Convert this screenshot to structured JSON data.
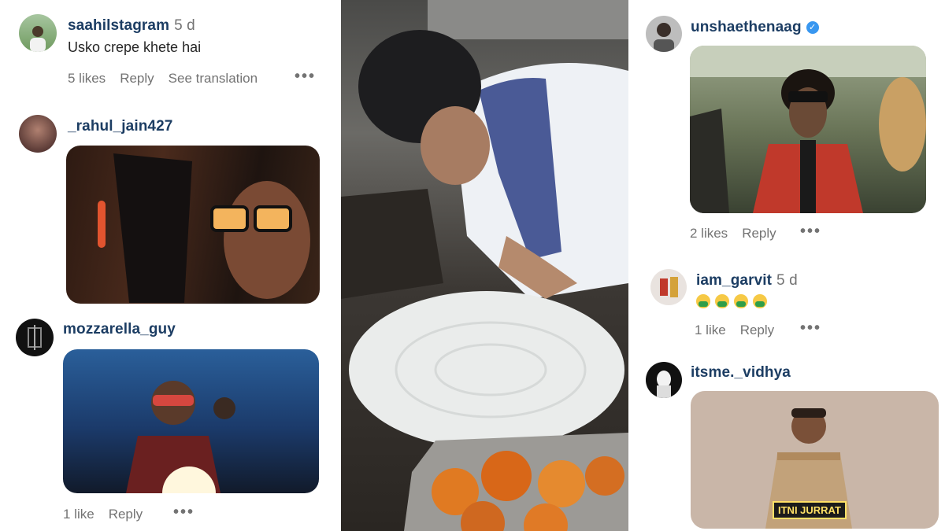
{
  "comments": [
    {
      "username": "saahilstagram",
      "time": "5 d",
      "text": "Usko crepe khete hai",
      "likes": "5 likes",
      "reply": "Reply",
      "translate": "See translation",
      "more": "•••"
    },
    {
      "username": "_rahul_jain427"
    },
    {
      "username": "mozzarella_guy",
      "likes": "1 like",
      "reply": "Reply",
      "more": "•••"
    },
    {
      "username": "unshaethenaag",
      "verified": true,
      "likes": "2 likes",
      "reply": "Reply",
      "more": "•••"
    },
    {
      "username": "iam_garvit",
      "time": "5 d",
      "emoji_count": 4,
      "likes": "1 like",
      "reply": "Reply",
      "more": "•••"
    },
    {
      "username": "itsme._vidhya",
      "gif_caption": "ITNI JURRAT"
    }
  ],
  "icons": {
    "more": "more-options-icon",
    "verified": "verified-badge-icon"
  },
  "colors": {
    "username": "#1c3d63",
    "meta": "#737373",
    "verified": "#3897f0"
  }
}
